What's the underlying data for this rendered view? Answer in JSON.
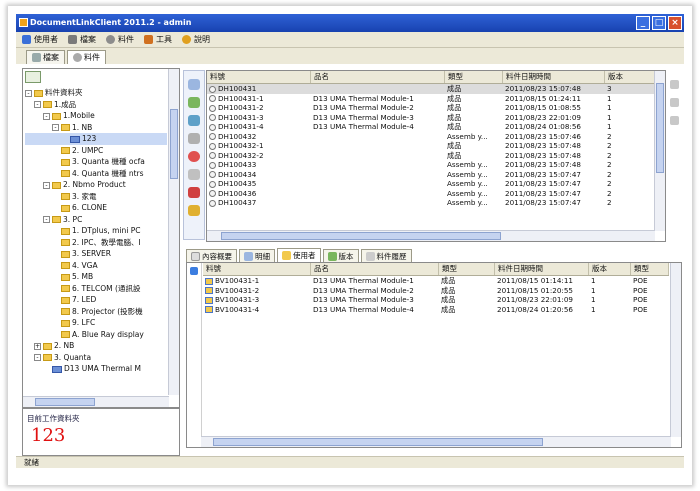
{
  "window": {
    "title": "DocumentLinkClient 2011.2 - admin"
  },
  "menu": [
    {
      "label": "使用者",
      "color": "#3a6fd8"
    },
    {
      "label": "檔案",
      "color": "#7a7a7a"
    },
    {
      "label": "料件",
      "color": "#8c8c8c"
    },
    {
      "label": "工具",
      "color": "#d07020"
    },
    {
      "label": "說明",
      "color": "#e0a020"
    }
  ],
  "top_tabs": [
    {
      "label": "檔案",
      "active": false
    },
    {
      "label": "料件",
      "active": true
    }
  ],
  "tree": [
    {
      "label": "料件資料夾",
      "depth": 0,
      "toggle": "-",
      "icon": "folder"
    },
    {
      "label": "1.成品",
      "depth": 1,
      "toggle": "-",
      "icon": "folder"
    },
    {
      "label": "1.Mobile",
      "depth": 2,
      "toggle": "-",
      "icon": "folder"
    },
    {
      "label": "1. NB",
      "depth": 3,
      "toggle": "-",
      "icon": "folder"
    },
    {
      "label": "123",
      "depth": 4,
      "toggle": "",
      "icon": "doc",
      "selected": true
    },
    {
      "label": "2. UMPC",
      "depth": 3,
      "toggle": "",
      "icon": "folder"
    },
    {
      "label": "3. Quanta 機種 ocfa",
      "depth": 3,
      "toggle": "",
      "icon": "folder"
    },
    {
      "label": "4. Quanta 機種 ntrs",
      "depth": 3,
      "toggle": "",
      "icon": "folder"
    },
    {
      "label": "2. Nbmo Product",
      "depth": 2,
      "toggle": "-",
      "icon": "folder"
    },
    {
      "label": "3. 家電",
      "depth": 3,
      "toggle": "",
      "icon": "folder"
    },
    {
      "label": "6. CLONE",
      "depth": 3,
      "toggle": "",
      "icon": "folder"
    },
    {
      "label": "3. PC",
      "depth": 2,
      "toggle": "-",
      "icon": "folder"
    },
    {
      "label": "1. DTplus, mini PC",
      "depth": 3,
      "toggle": "",
      "icon": "folder"
    },
    {
      "label": "2. IPC、教學電腦、I",
      "depth": 3,
      "toggle": "",
      "icon": "folder"
    },
    {
      "label": "3. SERVER",
      "depth": 3,
      "toggle": "",
      "icon": "folder"
    },
    {
      "label": "4. VGA",
      "depth": 3,
      "toggle": "",
      "icon": "folder"
    },
    {
      "label": "5. MB",
      "depth": 3,
      "toggle": "",
      "icon": "folder"
    },
    {
      "label": "6. TELCOM (通訊設",
      "depth": 3,
      "toggle": "",
      "icon": "folder"
    },
    {
      "label": "7. LED",
      "depth": 3,
      "toggle": "",
      "icon": "folder"
    },
    {
      "label": "8. Projector (投影機",
      "depth": 3,
      "toggle": "",
      "icon": "folder"
    },
    {
      "label": "9. LFC",
      "depth": 3,
      "toggle": "",
      "icon": "folder"
    },
    {
      "label": "A. Blue Ray display",
      "depth": 3,
      "toggle": "",
      "icon": "folder"
    },
    {
      "label": "2. NB",
      "depth": 1,
      "toggle": "+",
      "icon": "folder"
    },
    {
      "label": "3. Quanta",
      "depth": 1,
      "toggle": "-",
      "icon": "folder"
    },
    {
      "label": "D13 UMA Thermal M",
      "depth": 2,
      "toggle": "",
      "icon": "doc"
    }
  ],
  "bottom_info": {
    "label": "目前工作資料夾",
    "value": "123"
  },
  "main_table": {
    "columns": [
      "料號",
      "品名",
      "類型",
      "料件日期時間",
      "版本"
    ],
    "rows": [
      [
        "DH100431",
        "",
        "成品",
        "2011/08/23 15:07:48",
        "3"
      ],
      [
        "DH100431-1",
        "D13 UMA Thermal Module-1",
        "成品",
        "2011/08/15 01:24:11",
        "1"
      ],
      [
        "DH100431-2",
        "D13 UMA Thermal Module-2",
        "成品",
        "2011/08/15 01:08:55",
        "1"
      ],
      [
        "DH100431-3",
        "D13 UMA Thermal Module-3",
        "成品",
        "2011/08/23 22:01:09",
        "1"
      ],
      [
        "DH100431-4",
        "D13 UMA Thermal Module-4",
        "成品",
        "2011/08/24 01:08:56",
        "1"
      ],
      [
        "DH100432",
        "",
        "Assemb y...",
        "2011/08/23 15:07:46",
        "2"
      ],
      [
        "DH100432-1",
        "",
        "成品",
        "2011/08/23 15:07:48",
        "2"
      ],
      [
        "DH100432-2",
        "",
        "成品",
        "2011/08/23 15:07:48",
        "2"
      ],
      [
        "DH100433",
        "",
        "Assemb y...",
        "2011/08/23 15:07:48",
        "2"
      ],
      [
        "DH100434",
        "",
        "Assemb y...",
        "2011/08/23 15:07:47",
        "2"
      ],
      [
        "DH100435",
        "",
        "Assemb y...",
        "2011/08/23 15:07:47",
        "2"
      ],
      [
        "DH100436",
        "",
        "Assemb y...",
        "2011/08/23 15:07:47",
        "2"
      ],
      [
        "DH100437",
        "",
        "Assemb y...",
        "2011/08/23 15:07:47",
        "2"
      ]
    ]
  },
  "sub_tabs": [
    {
      "label": "內容概要",
      "active": false
    },
    {
      "label": "明細",
      "active": false
    },
    {
      "label": "使用者",
      "active": true
    },
    {
      "label": "版本",
      "active": false
    },
    {
      "label": "料件履歷",
      "active": false
    }
  ],
  "detail_table": {
    "columns": [
      "料號",
      "品名",
      "類型",
      "料件日期時間",
      "版本",
      "類型"
    ],
    "rows": [
      [
        "BV100431-1",
        "D13 UMA Thermal Module-1",
        "成品",
        "2011/08/15 01:14:11",
        "1",
        "POE"
      ],
      [
        "BV100431-2",
        "D13 UMA Thermal Module-2",
        "成品",
        "2011/08/15 01:20:55",
        "1",
        "POE"
      ],
      [
        "BV100431-3",
        "D13 UMA Thermal Module-3",
        "成品",
        "2011/08/23 22:01:09",
        "1",
        "POE"
      ],
      [
        "BV100431-4",
        "D13 UMA Thermal Module-4",
        "成品",
        "2011/08/24 01:20:56",
        "1",
        "POE"
      ]
    ]
  },
  "status": {
    "text": "就緒"
  }
}
